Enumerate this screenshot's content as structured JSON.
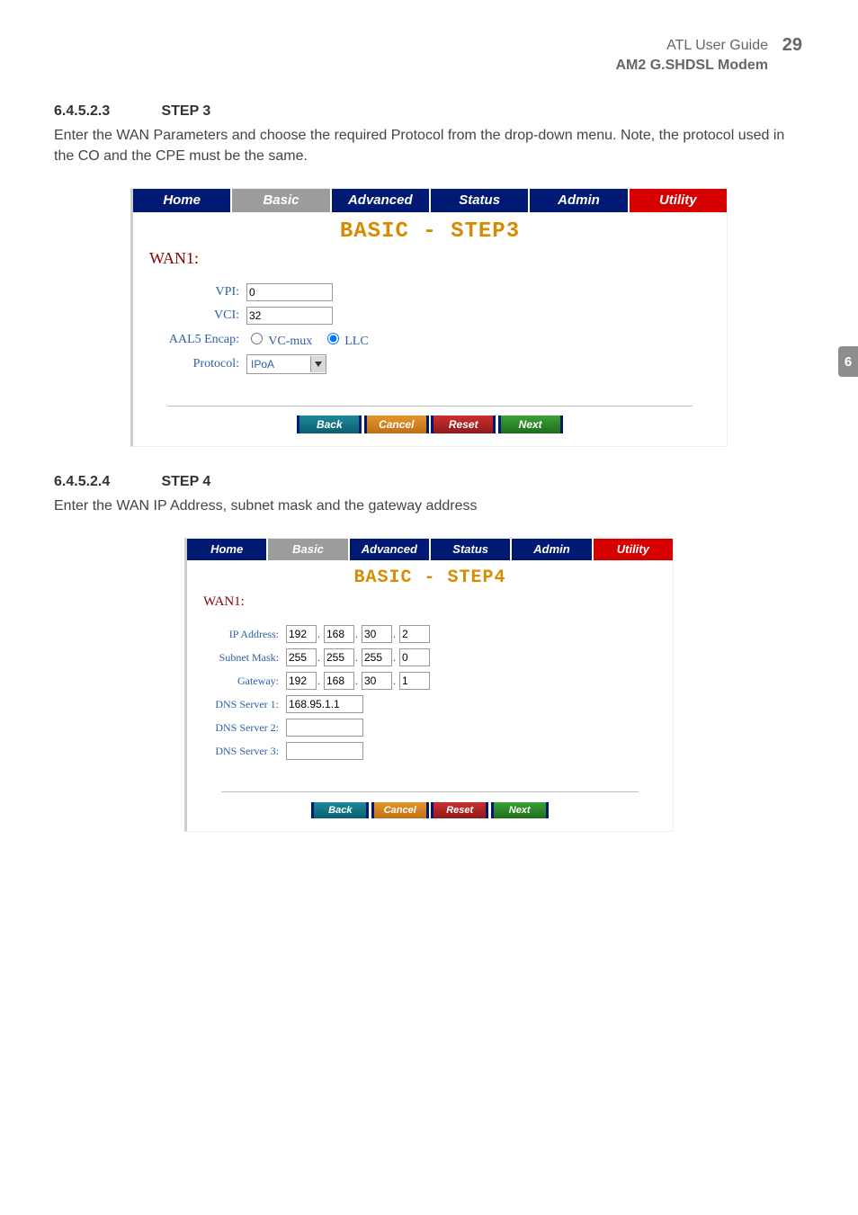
{
  "header": {
    "title1": "ATL User Guide",
    "title2": "AM2 G.SHDSL Modem",
    "page_number": "29",
    "side_tab": "6"
  },
  "section_step3": {
    "number": "6.4.5.2.3",
    "title": "STEP 3",
    "text": "Enter the WAN Parameters and choose the required Protocol from the drop-down menu. Note, the protocol used in the CO and the CPE must be the same."
  },
  "section_step4": {
    "number": "6.4.5.2.4",
    "title": "STEP 4",
    "text": "Enter the WAN IP Address, subnet mask and the gateway address"
  },
  "nav": {
    "home": "Home",
    "basic": "Basic",
    "advanced": "Advanced",
    "status": "Status",
    "admin": "Admin",
    "utility": "Utility"
  },
  "panel3": {
    "title": "BASIC - STEP3",
    "wan_label": "WAN1:",
    "vpi_label": "VPI:",
    "vpi_value": "0",
    "vci_label": "VCI:",
    "vci_value": "32",
    "aal5_label": "AAL5 Encap:",
    "aal5_opt1": "VC-mux",
    "aal5_opt2": "LLC",
    "protocol_label": "Protocol:",
    "protocol_value": "IPoA"
  },
  "panel4": {
    "title": "BASIC - STEP4",
    "wan_label": "WAN1:",
    "ip_label": "IP Address:",
    "ip": [
      "192",
      "168",
      "30",
      "2"
    ],
    "mask_label": "Subnet Mask:",
    "mask": [
      "255",
      "255",
      "255",
      "0"
    ],
    "gw_label": "Gateway:",
    "gw": [
      "192",
      "168",
      "30",
      "1"
    ],
    "dns1_label": "DNS Server 1:",
    "dns1_value": "168.95.1.1",
    "dns2_label": "DNS Server 2:",
    "dns2_value": "",
    "dns3_label": "DNS Server 3:",
    "dns3_value": ""
  },
  "buttons": {
    "back": "Back",
    "cancel": "Cancel",
    "reset": "Reset",
    "next": "Next"
  }
}
